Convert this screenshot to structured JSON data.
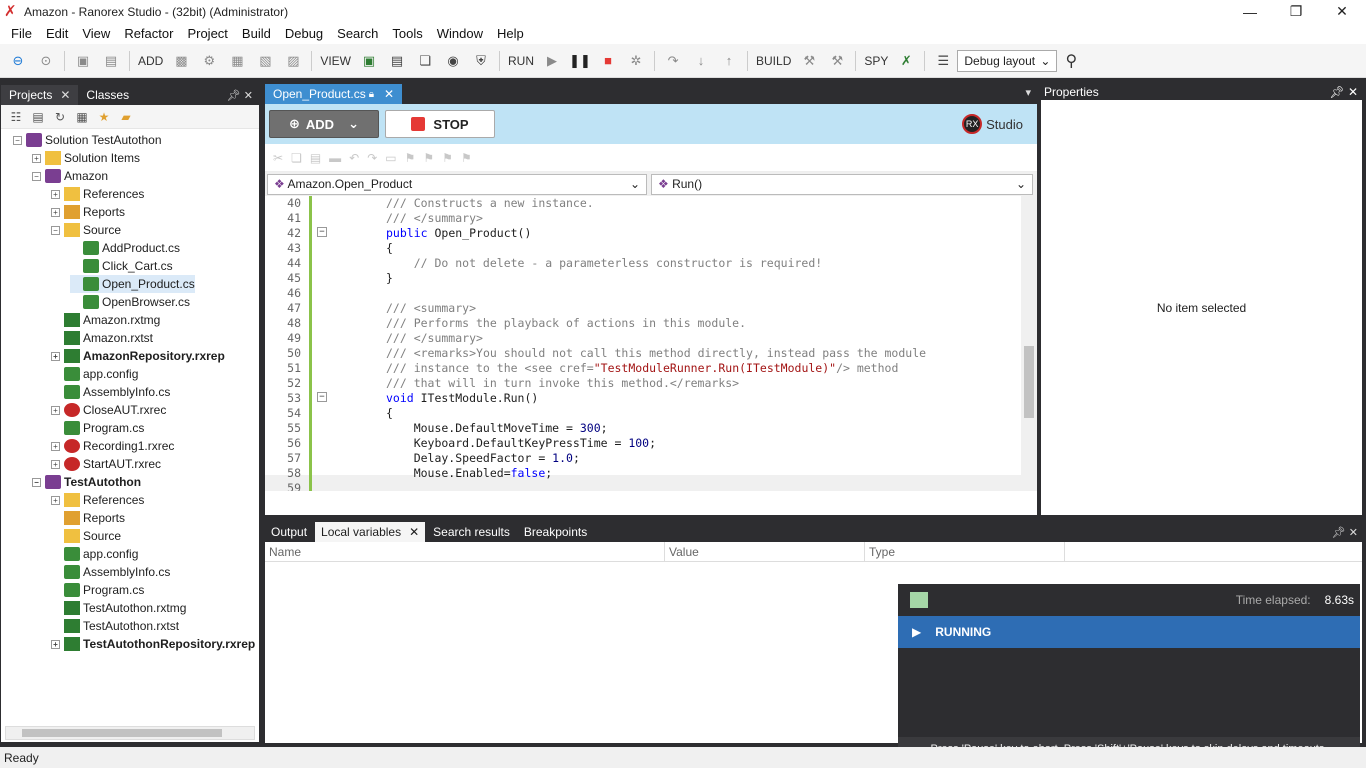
{
  "window": {
    "title": "Amazon - Ranorex Studio - (32bit) (Administrator)",
    "min": "—",
    "max": "❐",
    "close": "✕"
  },
  "menu": [
    "File",
    "Edit",
    "View",
    "Refactor",
    "Project",
    "Build",
    "Debug",
    "Search",
    "Tools",
    "Window",
    "Help"
  ],
  "toolbar": {
    "add": "ADD",
    "view": "VIEW",
    "run": "RUN",
    "build": "BUILD",
    "spy": "SPY",
    "layout": "Debug layout"
  },
  "left_panel": {
    "tabs": [
      {
        "label": "Projects",
        "active": true
      },
      {
        "label": "Classes",
        "active": false
      }
    ],
    "tree": [
      {
        "label": "Solution TestAutothon",
        "icon": "sol",
        "indent": 0,
        "exp": "−"
      },
      {
        "label": "Solution Items",
        "icon": "fold",
        "indent": 1,
        "exp": "+"
      },
      {
        "label": "Amazon",
        "icon": "sol",
        "indent": 1,
        "exp": "−"
      },
      {
        "label": "References",
        "icon": "fold",
        "indent": 2,
        "exp": "+"
      },
      {
        "label": "Reports",
        "icon": "bar",
        "indent": 2,
        "exp": "+"
      },
      {
        "label": "Source",
        "icon": "fold",
        "indent": 2,
        "exp": "−"
      },
      {
        "label": "AddProduct.cs",
        "icon": "cs",
        "indent": 3,
        "exp": ""
      },
      {
        "label": "Click_Cart.cs",
        "icon": "cs",
        "indent": 3,
        "exp": ""
      },
      {
        "label": "Open_Product.cs",
        "icon": "cs",
        "indent": 3,
        "exp": "",
        "selected": true
      },
      {
        "label": "OpenBrowser.cs",
        "icon": "cs",
        "indent": 3,
        "exp": ""
      },
      {
        "label": "Amazon.rxtmg",
        "icon": "rep",
        "indent": 2,
        "exp": ""
      },
      {
        "label": "Amazon.rxtst",
        "icon": "rep",
        "indent": 2,
        "exp": ""
      },
      {
        "label": "AmazonRepository.rxrep",
        "icon": "rep",
        "indent": 2,
        "exp": "+",
        "bold": true
      },
      {
        "label": "app.config",
        "icon": "cs",
        "indent": 2,
        "exp": ""
      },
      {
        "label": "AssemblyInfo.cs",
        "icon": "cs",
        "indent": 2,
        "exp": ""
      },
      {
        "label": "CloseAUT.rxrec",
        "icon": "rec",
        "indent": 2,
        "exp": "+"
      },
      {
        "label": "Program.cs",
        "icon": "cs",
        "indent": 2,
        "exp": ""
      },
      {
        "label": "Recording1.rxrec",
        "icon": "rec",
        "indent": 2,
        "exp": "+"
      },
      {
        "label": "StartAUT.rxrec",
        "icon": "rec",
        "indent": 2,
        "exp": "+"
      },
      {
        "label": "TestAutothon",
        "icon": "sol",
        "indent": 1,
        "exp": "−",
        "bold": true
      },
      {
        "label": "References",
        "icon": "fold",
        "indent": 2,
        "exp": "+"
      },
      {
        "label": "Reports",
        "icon": "bar",
        "indent": 2,
        "exp": ""
      },
      {
        "label": "Source",
        "icon": "fold",
        "indent": 2,
        "exp": ""
      },
      {
        "label": "app.config",
        "icon": "cs",
        "indent": 2,
        "exp": ""
      },
      {
        "label": "AssemblyInfo.cs",
        "icon": "cs",
        "indent": 2,
        "exp": ""
      },
      {
        "label": "Program.cs",
        "icon": "cs",
        "indent": 2,
        "exp": ""
      },
      {
        "label": "TestAutothon.rxtmg",
        "icon": "rep",
        "indent": 2,
        "exp": ""
      },
      {
        "label": "TestAutothon.rxtst",
        "icon": "rep",
        "indent": 2,
        "exp": ""
      },
      {
        "label": "TestAutothonRepository.rxrep",
        "icon": "rep",
        "indent": 2,
        "exp": "+",
        "bold": true
      }
    ]
  },
  "editor": {
    "tab": "Open_Product.cs",
    "add_label": "ADD",
    "stop_label": "STOP",
    "studio_label": "Studio",
    "class_dropdown": "Amazon.Open_Product",
    "member_dropdown": "Run()",
    "lines": [
      {
        "n": "40",
        "segs": [
          {
            "t": "/// Constructs a new instance.",
            "c": "cm"
          }
        ]
      },
      {
        "n": "41",
        "segs": [
          {
            "t": "/// </summary>",
            "c": "cm"
          }
        ]
      },
      {
        "n": "42",
        "segs": [
          {
            "t": "public ",
            "c": "kw"
          },
          {
            "t": "Open_Product()",
            "c": ""
          }
        ],
        "fold": "−"
      },
      {
        "n": "43",
        "segs": [
          {
            "t": "{",
            "c": ""
          }
        ]
      },
      {
        "n": "44",
        "segs": [
          {
            "t": "    // Do not delete - a parameterless constructor is required!",
            "c": "cm"
          }
        ]
      },
      {
        "n": "45",
        "segs": [
          {
            "t": "}",
            "c": ""
          }
        ]
      },
      {
        "n": "46",
        "segs": []
      },
      {
        "n": "47",
        "segs": [
          {
            "t": "/// <summary>",
            "c": "cm"
          }
        ]
      },
      {
        "n": "48",
        "segs": [
          {
            "t": "/// Performs the playback of actions in this module.",
            "c": "cm"
          }
        ]
      },
      {
        "n": "49",
        "segs": [
          {
            "t": "/// </summary>",
            "c": "cm"
          }
        ]
      },
      {
        "n": "50",
        "segs": [
          {
            "t": "/// <remarks>",
            "c": "cm"
          },
          {
            "t": "You should not call this method directly, instead pass the module",
            "c": "cm"
          }
        ]
      },
      {
        "n": "51",
        "segs": [
          {
            "t": "/// instance to the ",
            "c": "cm"
          },
          {
            "t": "<see cref=",
            "c": "cm"
          },
          {
            "t": "\"TestModuleRunner.Run(ITestModule)\"",
            "c": "str"
          },
          {
            "t": "/> method",
            "c": "cm"
          }
        ]
      },
      {
        "n": "52",
        "segs": [
          {
            "t": "/// that will in turn invoke this method.</remarks>",
            "c": "cm"
          }
        ]
      },
      {
        "n": "53",
        "segs": [
          {
            "t": "void ",
            "c": "kw"
          },
          {
            "t": "ITestModule.Run()",
            "c": ""
          }
        ],
        "fold": "−"
      },
      {
        "n": "54",
        "segs": [
          {
            "t": "{",
            "c": ""
          }
        ]
      },
      {
        "n": "55",
        "segs": [
          {
            "t": "    Mouse.DefaultMoveTime = ",
            "c": ""
          },
          {
            "t": "300",
            "c": "num"
          },
          {
            "t": ";",
            "c": ""
          }
        ]
      },
      {
        "n": "56",
        "segs": [
          {
            "t": "    Keyboard.DefaultKeyPressTime = ",
            "c": ""
          },
          {
            "t": "100",
            "c": "num"
          },
          {
            "t": ";",
            "c": ""
          }
        ]
      },
      {
        "n": "57",
        "segs": [
          {
            "t": "    Delay.SpeedFactor = ",
            "c": ""
          },
          {
            "t": "1.0",
            "c": "num"
          },
          {
            "t": ";",
            "c": ""
          }
        ]
      },
      {
        "n": "58",
        "segs": [
          {
            "t": "    Mouse.Enabled=",
            "c": ""
          },
          {
            "t": "false",
            "c": "kw"
          },
          {
            "t": ";",
            "c": ""
          }
        ]
      },
      {
        "n": "59",
        "segs": []
      }
    ]
  },
  "properties": {
    "title": "Properties",
    "empty": "No item selected"
  },
  "bottom": {
    "tabs": [
      {
        "label": "Output",
        "active": false,
        "close": false
      },
      {
        "label": "Local variables",
        "active": true,
        "close": true
      },
      {
        "label": "Search results",
        "active": false,
        "close": false
      },
      {
        "label": "Breakpoints",
        "active": false,
        "close": false
      }
    ],
    "columns": [
      "Name",
      "Value",
      "Type"
    ]
  },
  "run_panel": {
    "time_label": "Time elapsed:",
    "time_value": "8.63s",
    "state": "RUNNING",
    "footer": "Press 'Pause' key to abort. Press 'Shift'+'Pause' keys to skip delays and timeouts."
  },
  "status": {
    "text": "Ready"
  }
}
